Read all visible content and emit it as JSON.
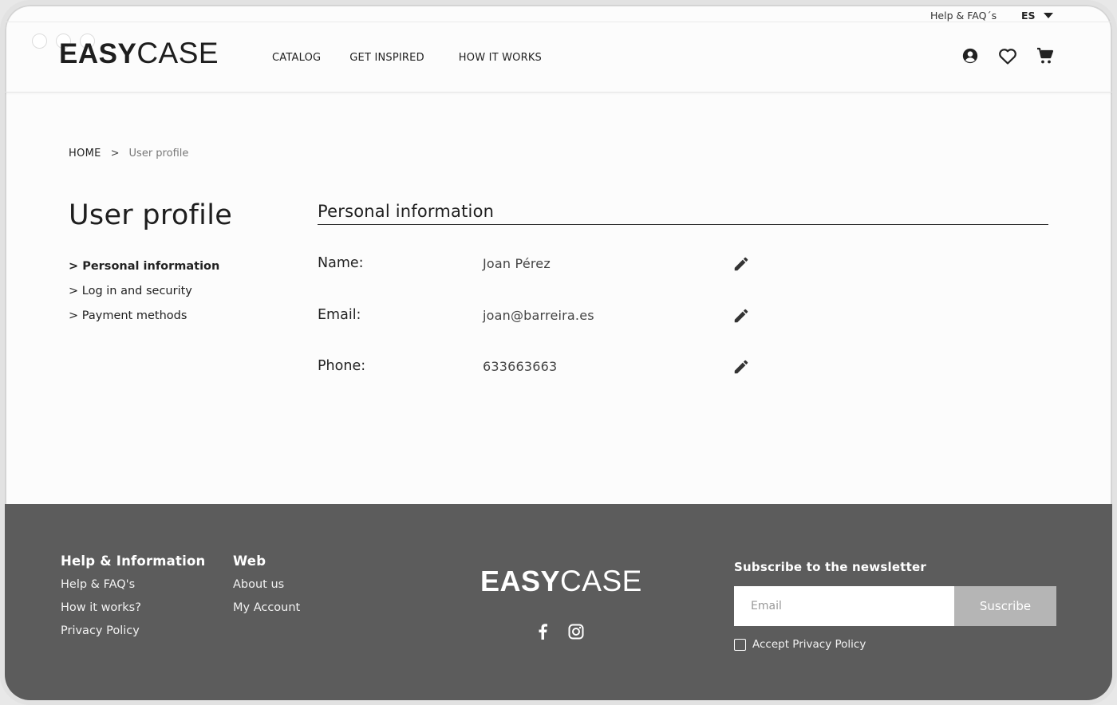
{
  "topbar": {
    "help_label": "Help & FAQ´s",
    "lang": "ES"
  },
  "header": {
    "logo_bold": "EASY",
    "logo_light": "CASE",
    "nav": [
      "CATALOG",
      "GET INSPIRED",
      "HOW IT WORKS"
    ],
    "icons": [
      "account-icon",
      "heart-icon",
      "cart-icon"
    ]
  },
  "breadcrumb": {
    "home": "HOME",
    "separator": ">",
    "current": "User profile"
  },
  "page": {
    "title": "User profile",
    "sidebar": [
      {
        "label": "> Personal information",
        "active": true
      },
      {
        "label": "> Log in and security",
        "active": false
      },
      {
        "label": "> Payment methods",
        "active": false
      }
    ],
    "section_title": "Personal information",
    "fields": [
      {
        "label": "Name:",
        "value": "Joan Pérez"
      },
      {
        "label": "Email:",
        "value": "joan@barreira.es"
      },
      {
        "label": "Phone:",
        "value": "633663663"
      }
    ]
  },
  "footer": {
    "col1": {
      "title": "Help & Information",
      "links": [
        "Help & FAQ's",
        "How it works?",
        "Privacy Policy"
      ]
    },
    "col2": {
      "title": "Web",
      "links": [
        "About us",
        "My Account"
      ]
    },
    "logo_bold": "EASY",
    "logo_light": "CASE",
    "social": [
      "facebook-icon",
      "instagram-icon"
    ],
    "newsletter": {
      "title": "Subscribe to the newsletter",
      "placeholder": "Email",
      "button": "Suscribe",
      "checkbox_label": "Accept Privacy Policy"
    }
  },
  "colors": {
    "footer_bg": "#5c5c5c",
    "button_bg": "#b5b5b5",
    "text": "#222222"
  }
}
